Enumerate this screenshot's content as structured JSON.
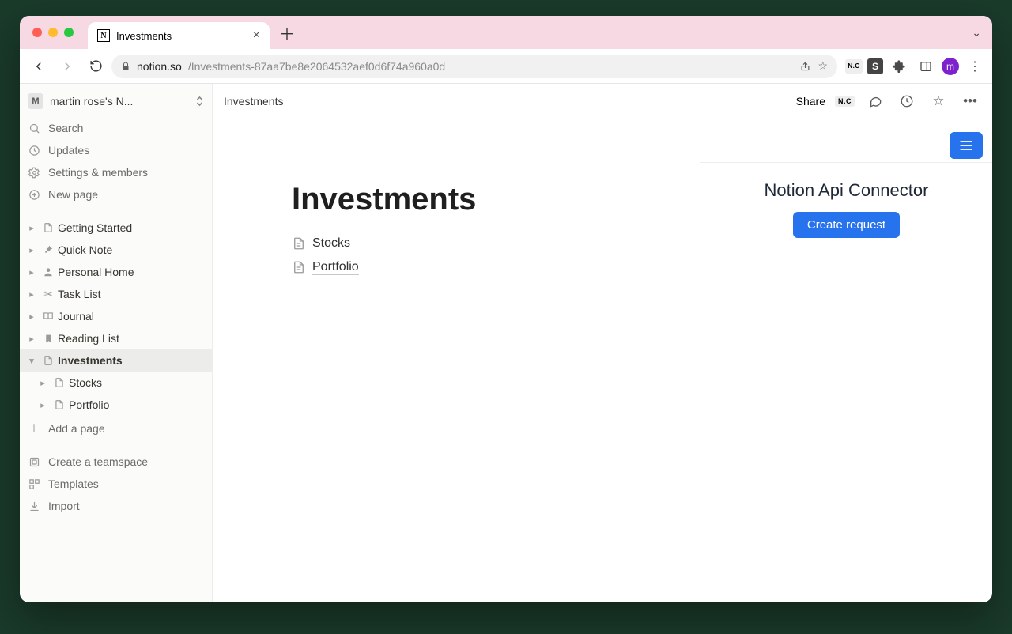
{
  "browser": {
    "tab_title": "Investments",
    "url_host": "notion.so",
    "url_path": "/Investments-87aa7be8e2064532aef0d6f74a960a0d",
    "avatar_letter": "m"
  },
  "workspace": {
    "avatar_letter": "M",
    "name": "martin rose's N..."
  },
  "sidebar_top": [
    {
      "icon": "search",
      "label": "Search"
    },
    {
      "icon": "clock",
      "label": "Updates"
    },
    {
      "icon": "gear",
      "label": "Settings & members"
    },
    {
      "icon": "plus-circle",
      "label": "New page"
    }
  ],
  "pages": [
    {
      "icon": "doc",
      "label": "Getting Started",
      "expanded": false,
      "active": false,
      "indent": 0
    },
    {
      "icon": "pin",
      "label": "Quick Note",
      "expanded": false,
      "active": false,
      "indent": 0
    },
    {
      "icon": "person",
      "label": "Personal Home",
      "expanded": false,
      "active": false,
      "indent": 0
    },
    {
      "icon": "scissors",
      "label": "Task List",
      "expanded": false,
      "active": false,
      "indent": 0
    },
    {
      "icon": "book",
      "label": "Journal",
      "expanded": false,
      "active": false,
      "indent": 0
    },
    {
      "icon": "bookmark",
      "label": "Reading List",
      "expanded": false,
      "active": false,
      "indent": 0
    },
    {
      "icon": "doc",
      "label": "Investments",
      "expanded": true,
      "active": true,
      "indent": 0
    },
    {
      "icon": "doc",
      "label": "Stocks",
      "expanded": false,
      "active": false,
      "indent": 1
    },
    {
      "icon": "doc",
      "label": "Portfolio",
      "expanded": false,
      "active": false,
      "indent": 1
    }
  ],
  "add_page_label": "Add a page",
  "sidebar_bottom": [
    {
      "icon": "teamspace",
      "label": "Create a teamspace"
    },
    {
      "icon": "templates",
      "label": "Templates"
    },
    {
      "icon": "import",
      "label": "Import"
    }
  ],
  "topbar": {
    "breadcrumb": "Investments",
    "share_label": "Share"
  },
  "page": {
    "title": "Investments",
    "subpages": [
      "Stocks",
      "Portfolio"
    ]
  },
  "panel": {
    "title": "Notion Api Connector",
    "button": "Create request"
  }
}
